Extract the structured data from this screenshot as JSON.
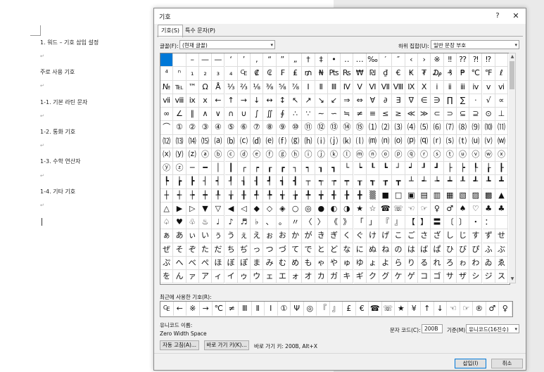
{
  "document": {
    "lines": [
      {
        "text": "1. 워드 – 기호 삽입 설정"
      },
      {
        "text": "주로 사용 기호"
      },
      {
        "text": "1-1. 기본 라틴 문자"
      },
      {
        "text": "1-2. 통화 기호"
      },
      {
        "text": "1-3. 수학 연산자"
      },
      {
        "text": "1-4. 기타 기호"
      }
    ],
    "para_mark": "↵"
  },
  "dialog": {
    "title": "기호",
    "help": "?",
    "close": "✕",
    "tabs": [
      {
        "label": "기호(S)",
        "active": true
      },
      {
        "label": "특수 문자(P)",
        "active": false
      }
    ],
    "font_label": "글꼴(F):",
    "font_value": "(현재 글꼴)",
    "subset_label": "하위 집합(U):",
    "subset_value": "일반 문장 부호",
    "symbols": [
      [
        "",
        "",
        "–",
        "—",
        "—",
        "‘",
        "’",
        "‚",
        "“",
        "”",
        "„",
        "†",
        "‡",
        "•",
        "‥",
        "…",
        "‰",
        "′",
        "″",
        "‹",
        "›",
        "※",
        "‼",
        "⁇",
        "⁈",
        "⁉"
      ],
      [
        "⁴",
        "ⁿ",
        "₁",
        "₂",
        "₃",
        "₄",
        "₠",
        "₡",
        "₢",
        "₣",
        "₤",
        "₥",
        "₦",
        "₧",
        "₨",
        "₩",
        "₪",
        "₫",
        "€",
        "₭",
        "₮",
        "₯",
        "₰",
        "₱",
        "℃",
        "℉",
        "ℓ"
      ],
      [
        "№",
        "℡",
        "™",
        "Ω",
        "Å",
        "⅓",
        "⅔",
        "⅛",
        "⅜",
        "⅝",
        "⅞",
        "Ⅰ",
        "Ⅱ",
        "Ⅲ",
        "Ⅳ",
        "Ⅴ",
        "Ⅵ",
        "Ⅶ",
        "Ⅷ",
        "Ⅸ",
        "Ⅹ",
        "ⅰ",
        "ⅱ",
        "ⅲ",
        "ⅳ",
        "ⅴ",
        "ⅵ"
      ],
      [
        "ⅶ",
        "ⅷ",
        "ⅸ",
        "ⅹ",
        "←",
        "↑",
        "→",
        "↓",
        "↔",
        "↕",
        "↖",
        "↗",
        "↘",
        "↙",
        "⇒",
        "⇔",
        "∀",
        "∂",
        "∃",
        "∇",
        "∈",
        "∋",
        "∏",
        "∑",
        "·",
        "√",
        "∝"
      ],
      [
        "∞",
        "∠",
        "∥",
        "∧",
        "∨",
        "∩",
        "∪",
        "∫",
        "∬",
        "∮",
        "∴",
        "∵",
        "∼",
        "∽",
        "≒",
        "≠",
        "≡",
        "≤",
        "≥",
        "≪",
        "≫",
        "⊂",
        "⊃",
        "⊆",
        "⊇",
        "⊙",
        "⊥"
      ],
      [
        "⌒",
        "①",
        "②",
        "③",
        "④",
        "⑤",
        "⑥",
        "⑦",
        "⑧",
        "⑨",
        "⑩",
        "⑪",
        "⑫",
        "⑬",
        "⑭",
        "⑮",
        "⑴",
        "⑵",
        "⑶",
        "⑷",
        "⑸",
        "⑹",
        "⑺",
        "⑻",
        "⑼",
        "⑽",
        "⑾"
      ],
      [
        "⑿",
        "⒀",
        "⒁",
        "⒂",
        "⒜",
        "⒝",
        "⒞",
        "⒟",
        "⒠",
        "⒡",
        "⒢",
        "⒣",
        "⒤",
        "⒥",
        "⒦",
        "⒧",
        "⒨",
        "⒩",
        "⒪",
        "⒫",
        "⒬",
        "⒭",
        "⒮",
        "⒯",
        "⒰",
        "⒱",
        "⒲"
      ],
      [
        "⒳",
        "⒴",
        "⒵",
        "ⓐ",
        "ⓑ",
        "ⓒ",
        "ⓓ",
        "ⓔ",
        "ⓕ",
        "ⓖ",
        "ⓗ",
        "ⓘ",
        "ⓙ",
        "ⓚ",
        "ⓛ",
        "ⓜ",
        "ⓝ",
        "ⓞ",
        "ⓟ",
        "ⓠ",
        "ⓡ",
        "ⓢ",
        "ⓣ",
        "ⓤ",
        "ⓥ",
        "ⓦ",
        "ⓧ"
      ],
      [
        "ⓨ",
        "ⓩ",
        "─",
        "━",
        "│",
        "┃",
        "┌",
        "┍",
        "┎",
        "┏",
        "┐",
        "┑",
        "┒",
        "┓",
        "└",
        "┕",
        "┖",
        "┗",
        "┘",
        "┙",
        "┚",
        "┛",
        "├",
        "┝",
        "┞",
        "┟",
        "┠"
      ],
      [
        "┡",
        "┢",
        "┣",
        "┤",
        "┥",
        "┦",
        "┧",
        "┨",
        "┩",
        "┪",
        "┫",
        "┬",
        "┭",
        "┮",
        "┯",
        "┰",
        "┱",
        "┲",
        "┳",
        "┴",
        "┵",
        "┶",
        "┷",
        "┸",
        "┹",
        "┺",
        "┻"
      ],
      [
        "┼",
        "┽",
        "┾",
        "┿",
        "╀",
        "╁",
        "╂",
        "╃",
        "╄",
        "╅",
        "╆",
        "╇",
        "╈",
        "╉",
        "╊",
        "╋",
        "▒",
        "■",
        "□",
        "▣",
        "▤",
        "▥",
        "▦",
        "▧",
        "▨",
        "▩",
        "▲"
      ],
      [
        "△",
        "▶",
        "▷",
        "▼",
        "▽",
        "◀",
        "◁",
        "◆",
        "◇",
        "◈",
        "○",
        "◎",
        "●",
        "◐",
        "◑",
        "★",
        "☆",
        "☎",
        "☏",
        "☜",
        "☞",
        "♀",
        "♂",
        "♠",
        "♡",
        "♣",
        "♣"
      ],
      [
        "♤",
        "♥",
        "♧",
        "♨",
        "♩",
        "♪",
        "♬",
        "♭",
        "、",
        "。",
        "〃",
        "〈",
        "〉",
        "《",
        "》",
        "「",
        "」",
        "『",
        "』",
        "【",
        "】",
        "〓",
        "〔",
        "〕",
        "・",
        "："
      ],
      [
        "ぁ",
        "あ",
        "ぃ",
        "い",
        "ぅ",
        "う",
        "ぇ",
        "え",
        "ぉ",
        "お",
        "か",
        "が",
        "き",
        "ぎ",
        "く",
        "ぐ",
        "け",
        "げ",
        "こ",
        "ご",
        "さ",
        "ざ",
        "し",
        "じ",
        "す",
        "ず",
        "せ"
      ],
      [
        "ぜ",
        "そ",
        "ぞ",
        "た",
        "だ",
        "ち",
        "ぢ",
        "っ",
        "つ",
        "づ",
        "て",
        "で",
        "と",
        "ど",
        "な",
        "に",
        "ぬ",
        "ね",
        "の",
        "は",
        "ば",
        "ぱ",
        "ひ",
        "び",
        "ぴ",
        "ふ",
        "ぶ"
      ],
      [
        "ぷ",
        "へ",
        "べ",
        "ぺ",
        "ほ",
        "ぼ",
        "ぽ",
        "ま",
        "み",
        "む",
        "め",
        "も",
        "ゃ",
        "や",
        "ゅ",
        "ゆ",
        "ょ",
        "よ",
        "ら",
        "り",
        "る",
        "れ",
        "ろ",
        "ゎ",
        "わ",
        "ゐ",
        "ゑ"
      ],
      [
        "を",
        "ん",
        "ァ",
        "ア",
        "ィ",
        "イ",
        "ゥ",
        "ウ",
        "ェ",
        "エ",
        "ォ",
        "オ",
        "カ",
        "ガ",
        "キ",
        "ギ",
        "ク",
        "グ",
        "ケ",
        "ゲ",
        "コ",
        "ゴ",
        "サ",
        "ザ",
        "シ",
        "ジ",
        "ス"
      ]
    ],
    "selected_index": [
      0,
      0
    ],
    "recent_label": "최근에 사용한 기호(R):",
    "recent_symbols": [
      "₠",
      "←",
      "※",
      "→",
      "℃",
      "≠",
      "Ⅲ",
      "Ⅱ",
      "Ⅰ",
      "①",
      "Ψ",
      "◎",
      "『",
      "』",
      "£",
      "€",
      "☎",
      "☏",
      "★",
      "¥",
      "↑",
      "↓",
      "☜",
      "☞",
      "®",
      "♂",
      "♀"
    ],
    "unicode_name_label": "유니코드 이름:",
    "unicode_name_value": "Zero Width Space",
    "char_code_label": "문자 코드(C):",
    "char_code_value": "200B",
    "from_label": "기준(M):",
    "from_value": "유니코드(16진수)",
    "autocorrect_label": "자동 고침(A)...",
    "shortcut_key_button": "바로 가기 키(K)...",
    "shortcut_key_text": "바로 가기 키: 200B, Alt+X",
    "insert_label": "삽입(I)",
    "cancel_label": "취소"
  },
  "colors": {
    "selection": "#0078d7",
    "dialog_bg": "#f0f0f0"
  }
}
